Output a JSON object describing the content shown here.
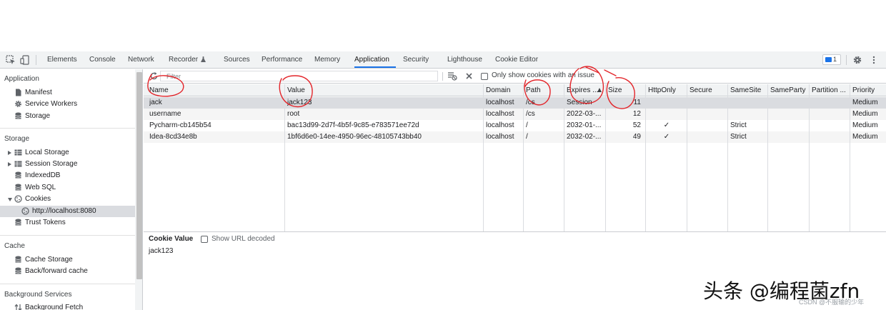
{
  "topbar": {
    "tabs": [
      {
        "label": "Elements"
      },
      {
        "label": "Console"
      },
      {
        "label": "Network"
      },
      {
        "label": "Recorder"
      },
      {
        "label": "Sources"
      },
      {
        "label": "Performance"
      },
      {
        "label": "Memory"
      },
      {
        "label": "Application",
        "active": true
      },
      {
        "label": "Security"
      },
      {
        "label": "Lighthouse"
      },
      {
        "label": "Cookie Editor"
      }
    ],
    "issues_count": "1",
    "accent_color": "#1a73e8"
  },
  "sidebar": {
    "application": {
      "header": "Application",
      "items": [
        {
          "label": "Manifest",
          "icon": "file-icon"
        },
        {
          "label": "Service Workers",
          "icon": "gear-icon"
        },
        {
          "label": "Storage",
          "icon": "database-icon"
        }
      ]
    },
    "storage": {
      "header": "Storage",
      "items": [
        {
          "label": "Local Storage",
          "icon": "grid-icon"
        },
        {
          "label": "Session Storage",
          "icon": "grid-icon"
        },
        {
          "label": "IndexedDB",
          "icon": "database-icon"
        },
        {
          "label": "Web SQL",
          "icon": "database-icon"
        },
        {
          "label": "Cookies",
          "icon": "cookie-icon"
        },
        {
          "label": "http://localhost:8080",
          "icon": "cookie-icon",
          "selected": true
        },
        {
          "label": "Trust Tokens",
          "icon": "database-icon"
        }
      ]
    },
    "cache": {
      "header": "Cache",
      "items": [
        {
          "label": "Cache Storage",
          "icon": "database-icon"
        },
        {
          "label": "Back/forward cache",
          "icon": "database-icon"
        }
      ]
    },
    "background": {
      "header": "Background Services",
      "items": [
        {
          "label": "Background Fetch",
          "icon": "arrows-icon"
        }
      ]
    }
  },
  "toolbar": {
    "filter_placeholder": "Filter",
    "only_issues_label": "Only show cookies with an issue"
  },
  "table": {
    "columns": [
      "Name",
      "Value",
      "Domain",
      "Path",
      "Expires ...",
      "Size",
      "HttpOnly",
      "Secure",
      "SameSite",
      "SameParty",
      "Partition ...",
      "Priority"
    ],
    "rows": [
      {
        "name": "jack",
        "value": "jack123",
        "domain": "localhost",
        "path": "/cs",
        "expires": "Session",
        "size": "11",
        "httponly": "",
        "secure": "",
        "samesite": "",
        "sameparty": "",
        "partition": "",
        "priority": "Medium"
      },
      {
        "name": "username",
        "value": "root",
        "domain": "localhost",
        "path": "/cs",
        "expires": "2022-03-...",
        "size": "12",
        "httponly": "",
        "secure": "",
        "samesite": "",
        "sameparty": "",
        "partition": "",
        "priority": "Medium"
      },
      {
        "name": "Pycharm-cb145b54",
        "value": "bac13d99-2d7f-4b5f-9c85-e783571ee72d",
        "domain": "localhost",
        "path": "/",
        "expires": "2032-01-...",
        "size": "52",
        "httponly": "✓",
        "secure": "",
        "samesite": "Strict",
        "sameparty": "",
        "partition": "",
        "priority": "Medium"
      },
      {
        "name": "Idea-8cd34e8b",
        "value": "1bf6d6e0-14ee-4950-96ec-48105743bb40",
        "domain": "localhost",
        "path": "/",
        "expires": "2032-02-...",
        "size": "49",
        "httponly": "✓",
        "secure": "",
        "samesite": "Strict",
        "sameparty": "",
        "partition": "",
        "priority": "Medium"
      }
    ]
  },
  "value_pane": {
    "title": "Cookie Value",
    "decode_label": "Show URL decoded",
    "value": "jack123"
  },
  "watermark": {
    "main": "头条 @编程菌zfn",
    "small": "CSDN @不服输的少年"
  }
}
